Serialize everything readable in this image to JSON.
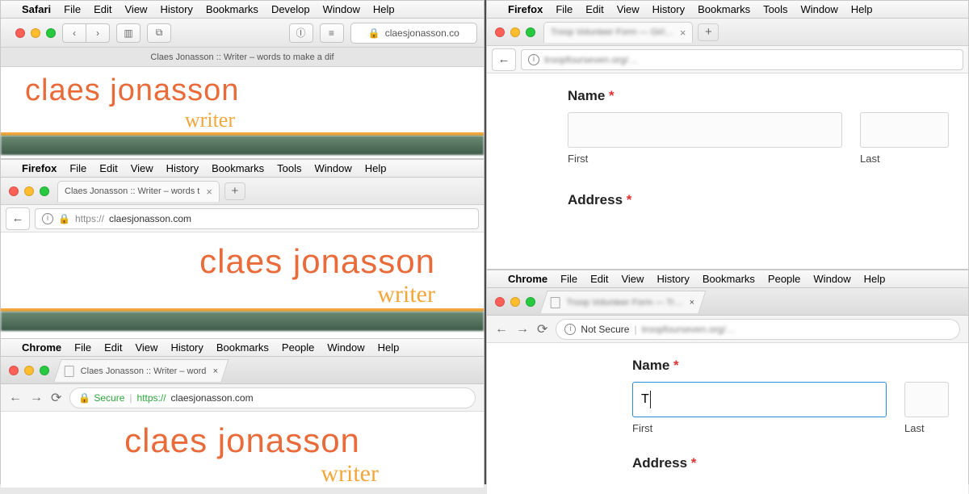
{
  "mac_menu": {
    "apple": "",
    "safari": {
      "app": "Safari",
      "items": [
        "File",
        "Edit",
        "View",
        "History",
        "Bookmarks",
        "Develop",
        "Window",
        "Help"
      ]
    },
    "firefox": {
      "app": "Firefox",
      "items": [
        "File",
        "Edit",
        "View",
        "History",
        "Bookmarks",
        "Tools",
        "Window",
        "Help"
      ]
    },
    "chrome": {
      "app": "Chrome",
      "items": [
        "File",
        "Edit",
        "View",
        "History",
        "Bookmarks",
        "People",
        "Window",
        "Help"
      ]
    }
  },
  "brand": {
    "name": "claes jonasson",
    "sub": "writer"
  },
  "left": {
    "safari": {
      "domain": "claesjonasson.co",
      "lock": "🔒",
      "tab_title": "Claes Jonasson :: Writer – words to make a dif"
    },
    "firefox": {
      "tab_title": "Claes Jonasson :: Writer – words t",
      "url_prefix": "https://",
      "url_host": "claesjonasson.com"
    },
    "chrome": {
      "tab_title": "Claes Jonasson :: Writer – word",
      "secure_label": "Secure",
      "url_scheme": "https://",
      "url_host": "claesjonasson.com"
    }
  },
  "right": {
    "firefox": {
      "tab_title_blurred": "Troop Volunteer Form — Girl…",
      "url_blurred": "troopfourseven.org/…"
    },
    "chrome": {
      "tab_title_blurred": "Troop Volunteer Form — Tr…",
      "not_secure": "Not Secure",
      "url_blurred": "troopfourseven.org/…"
    },
    "form": {
      "name_label": "Name",
      "address_label": "Address",
      "required": "*",
      "first_sub": "First",
      "last_sub": "Last",
      "typed_value": "T"
    }
  }
}
